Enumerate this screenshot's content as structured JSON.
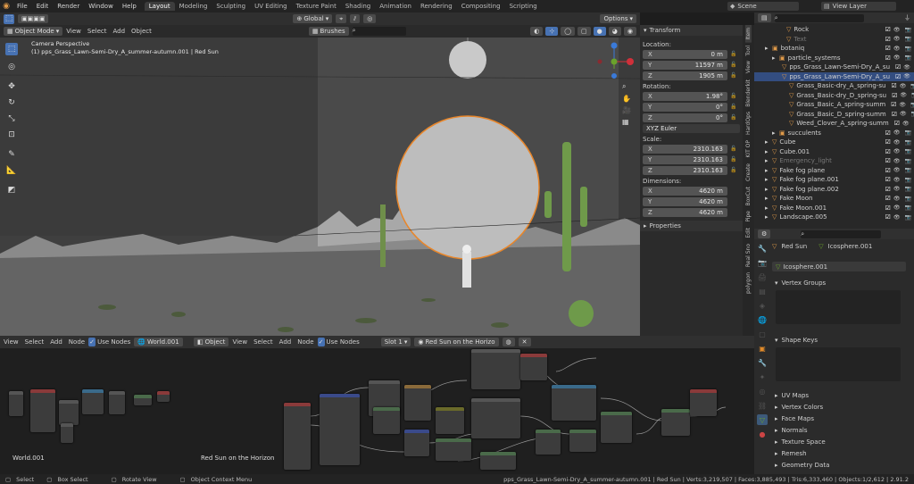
{
  "topbar": {
    "menus": [
      "File",
      "Edit",
      "Render",
      "Window",
      "Help"
    ],
    "workspaces": [
      "Layout",
      "Modeling",
      "Sculpting",
      "UV Editing",
      "Texture Paint",
      "Shading",
      "Animation",
      "Rendering",
      "Compositing",
      "Scripting"
    ],
    "active_workspace": "Layout",
    "scene": "Scene",
    "view_layer": "View Layer"
  },
  "viewport_toolbar": {
    "transform_orientation": "Global",
    "options": "Options"
  },
  "viewport_header": {
    "mode": "Object Mode",
    "menus": [
      "View",
      "Select",
      "Add",
      "Object"
    ],
    "brushes": "Brushes"
  },
  "viewport_info": {
    "line1": "Camera Perspective",
    "line2": "(1) pps_Grass_Lawn-Semi-Dry_A_summer-autumn.001 | Red Sun"
  },
  "npanel": {
    "transform_title": "Transform",
    "location_label": "Location:",
    "location": [
      {
        "axis": "X",
        "value": "0 m"
      },
      {
        "axis": "Y",
        "value": "11597 m"
      },
      {
        "axis": "Z",
        "value": "1905 m"
      }
    ],
    "rotation_label": "Rotation:",
    "rotation": [
      {
        "axis": "X",
        "value": "1.98°"
      },
      {
        "axis": "Y",
        "value": "0°"
      },
      {
        "axis": "Z",
        "value": "0°"
      }
    ],
    "rotation_mode": "XYZ Euler",
    "scale_label": "Scale:",
    "scale": [
      {
        "axis": "X",
        "value": "2310.163"
      },
      {
        "axis": "Y",
        "value": "2310.163"
      },
      {
        "axis": "Z",
        "value": "2310.163"
      }
    ],
    "dimensions_label": "Dimensions:",
    "dimensions": [
      {
        "axis": "X",
        "value": "4620 m"
      },
      {
        "axis": "Y",
        "value": "4620 m"
      },
      {
        "axis": "Z",
        "value": "4620 m"
      }
    ],
    "properties_title": "Properties",
    "side_tabs": [
      "Item",
      "Tool",
      "View",
      "Blenderkit",
      "HardOps",
      "KIT OP",
      "Create",
      "BoxCut",
      "Pipe",
      "Edit",
      "Real Sno",
      "polygon"
    ]
  },
  "outliner": {
    "rows": [
      {
        "label": "Rock",
        "indent": 3
      },
      {
        "label": "Text",
        "indent": 3
      },
      {
        "label": "botaniq",
        "indent": 1
      },
      {
        "label": "particle_systems",
        "indent": 2
      },
      {
        "label": "pps_Grass_Lawn-Semi-Dry_A_su",
        "indent": 3
      },
      {
        "label": "pps_Grass_Lawn-Semi-Dry_A_su",
        "indent": 3
      },
      {
        "label": "Grass_Basic-dry_A_spring-su",
        "indent": 4
      },
      {
        "label": "Grass_Basic-dry_D_spring-su",
        "indent": 4
      },
      {
        "label": "Grass_Basic_A_spring-summ",
        "indent": 4
      },
      {
        "label": "Grass_Basic_D_spring-summ",
        "indent": 4
      },
      {
        "label": "Weed_Clover_A_spring-summ",
        "indent": 4
      },
      {
        "label": "succulents",
        "indent": 2
      },
      {
        "label": "Cube",
        "indent": 1
      },
      {
        "label": "Cube.001",
        "indent": 1
      },
      {
        "label": "Emergency_light",
        "indent": 1
      },
      {
        "label": "Fake fog plane",
        "indent": 1
      },
      {
        "label": "Fake fog plane.001",
        "indent": 1
      },
      {
        "label": "Fake fog plane.002",
        "indent": 1
      },
      {
        "label": "Fake Moon",
        "indent": 1
      },
      {
        "label": "Fake Moon.001",
        "indent": 1
      },
      {
        "label": "Landscape.005",
        "indent": 1
      }
    ]
  },
  "properties": {
    "object": "Red Sun",
    "mesh": "Icosphere.001",
    "mesh_field": "Icosphere.001",
    "vertex_groups": "Vertex Groups",
    "shape_keys": "Shape Keys",
    "collapsed": [
      "UV Maps",
      "Vertex Colors",
      "Face Maps",
      "Normals",
      "Texture Space",
      "Remesh",
      "Geometry Data"
    ]
  },
  "world_editor": {
    "menus": [
      "View",
      "Select",
      "Add",
      "Node"
    ],
    "use_nodes": "Use Nodes",
    "world": "World.001",
    "label": "World.001"
  },
  "shader_editor": {
    "type": "Object",
    "menus": [
      "View",
      "Select",
      "Add",
      "Node"
    ],
    "use_nodes": "Use Nodes",
    "slot": "Slot 1",
    "material": "Red Sun on the Horizo",
    "label": "Red Sun on the Horizon"
  },
  "status": {
    "items": [
      "Select",
      "Box Select",
      "Rotate View",
      "Object Context Menu"
    ],
    "info": "pps_Grass_Lawn-Semi-Dry_A_summer-autumn.001 | Red Sun | Verts:3,219,507 | Faces:3,885,493 | Tris:6,333,460 | Objects:1/2,612 | 2.91.2"
  },
  "colors": {
    "accent": "#4772b3",
    "selection": "#e8862a",
    "header": "#303030",
    "panel": "#2b2b2b"
  }
}
